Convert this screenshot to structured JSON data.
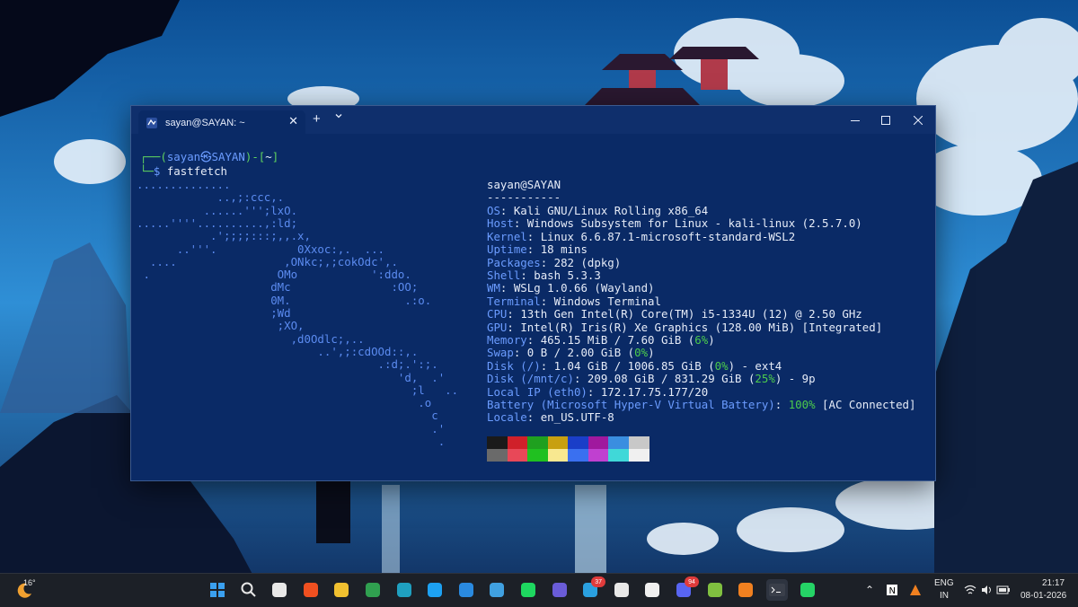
{
  "terminal": {
    "tab_title": "sayan@SAYAN: ~",
    "new_tab": "+",
    "dropdown": "⌄",
    "prompt": {
      "open": "┌──(",
      "user": "sayan",
      "at_sym": "㉿",
      "host": "SAYAN",
      "mid": ")-[",
      "path": "~",
      "close": "]",
      "line2_prefix": "└─",
      "dollar": "$",
      "command": " fastfetch"
    },
    "logo_lines": [
      "..............",
      "            ..,;:ccc,.",
      "          ......''';lxO.",
      ".....''''..........,:ld;",
      "           .';;;;:::;,,.x,",
      "      ..'''.            0Xxoc:,.  ...",
      "  ....                ,ONkc;,;cokOdc',.",
      " .                   OMo           ':ddo.",
      "                    dMc               :OO;",
      "                    0M.                 .:o.",
      "                    ;Wd",
      "                     ;XO,",
      "                       ,d0Odlc;,..",
      "                           ..',;:cdOOd::,.",
      "                                    .:d;.':;.",
      "                                       'd,  .'",
      "                                         ;l   ..",
      "                                          .o",
      "                                            c",
      "                                            .'",
      "                                             ."
    ],
    "user_host": "sayan@SAYAN",
    "separator": "-----------",
    "info": [
      {
        "label": "OS",
        "value": " Kali GNU/Linux Rolling x86_64"
      },
      {
        "label": "Host",
        "value": " Windows Subsystem for Linux - kali-linux (2.5.7.0)"
      },
      {
        "label": "Kernel",
        "value": " Linux 6.6.87.1-microsoft-standard-WSL2"
      },
      {
        "label": "Uptime",
        "value": " 18 mins"
      },
      {
        "label": "Packages",
        "value": " 282 (dpkg)"
      },
      {
        "label": "Shell",
        "value": " bash 5.3.3"
      },
      {
        "label": "WM",
        "value": " WSLg 1.0.66 (Wayland)"
      },
      {
        "label": "Terminal",
        "value": " Windows Terminal"
      },
      {
        "label": "CPU",
        "value": " 13th Gen Intel(R) Core(TM) i5-1334U (12) @ 2.50 GHz"
      },
      {
        "label": "GPU",
        "value": " Intel(R) Iris(R) Xe Graphics (128.00 MiB) [Integrated]"
      },
      {
        "label": "Memory",
        "value": " 465.15 MiB / 7.60 GiB (",
        "pct": "6%",
        "tail": ")"
      },
      {
        "label": "Swap",
        "value": " 0 B / 2.00 GiB (",
        "pct": "0%",
        "tail": ")"
      },
      {
        "label": "Disk (/)",
        "value": " 1.04 GiB / 1006.85 GiB (",
        "pct": "0%",
        "tail": ") - ext4"
      },
      {
        "label": "Disk (/mnt/c)",
        "value": " 209.08 GiB / 831.29 GiB (",
        "pct": "25%",
        "tail": ") - 9p"
      },
      {
        "label": "Local IP (eth0)",
        "value": " 172.17.75.177/20"
      },
      {
        "label": "Battery (Microsoft Hyper-V Virtual Battery)",
        "value": " ",
        "pct": "100%",
        "tail": " [AC Connected]"
      },
      {
        "label": "Locale",
        "value": " en_US.UTF-8"
      }
    ],
    "palette_top": [
      "#1a1a1a",
      "#d0202a",
      "#1fa01f",
      "#c8a010",
      "#1a3ec8",
      "#a0189e",
      "#3a8ee0",
      "#c8c8c8"
    ],
    "palette_bottom": [
      "#6a6a6a",
      "#e84858",
      "#20c020",
      "#f8e890",
      "#3a70f0",
      "#c040d0",
      "#40d8d8",
      "#f0f0f0"
    ]
  },
  "taskbar": {
    "weather_temp": "16°",
    "pinned_icons": [
      "start-icon",
      "search-icon",
      "task-view-icon",
      "brave-icon",
      "file-explorer-icon",
      "chrome-icon",
      "edge-icon",
      "twitter-icon",
      "vscode-icon",
      "photos-icon",
      "spotify-icon",
      "prime-video-icon",
      "telegram-icon",
      "dev-to-icon",
      "notion-icon",
      "discord-icon",
      "kali-icon",
      "vlc-icon",
      "terminal-icon",
      "whatsapp-icon"
    ],
    "telegram_badge": "37",
    "discord_badge": "94",
    "lang_top": "ENG",
    "lang_bottom": "IN",
    "time": "21:17",
    "date": "08-01-2026"
  }
}
